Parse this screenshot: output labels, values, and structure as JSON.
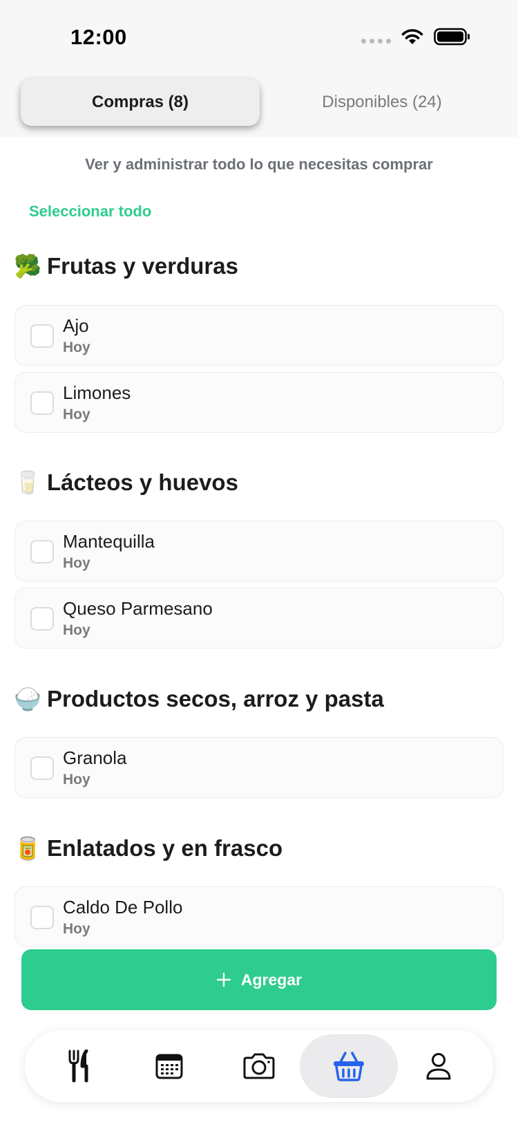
{
  "status_bar": {
    "time": "12:00"
  },
  "tabs": [
    {
      "label": "Compras (8)",
      "active": true
    },
    {
      "label": "Disponibles (24)",
      "active": false
    }
  ],
  "subtitle": "Ver y administrar todo lo que necesitas comprar",
  "select_all": "Seleccionar todo",
  "sections": [
    {
      "emoji": "🥦",
      "title": "Frutas y verduras",
      "items": [
        {
          "name": "Ajo",
          "when": "Hoy"
        },
        {
          "name": "Limones",
          "when": "Hoy"
        }
      ]
    },
    {
      "emoji": "🥛",
      "title": "Lácteos y huevos",
      "items": [
        {
          "name": "Mantequilla",
          "when": "Hoy"
        },
        {
          "name": "Queso Parmesano",
          "when": "Hoy"
        }
      ]
    },
    {
      "emoji": "🍚",
      "title": "Productos secos, arroz y pasta",
      "items": [
        {
          "name": "Granola",
          "when": "Hoy"
        }
      ]
    },
    {
      "emoji": "🥫",
      "title": "Enlatados y en frasco",
      "items": [
        {
          "name": "Caldo De Pollo",
          "when": "Hoy"
        }
      ]
    }
  ],
  "add_button": {
    "label": "Agregar"
  },
  "bottom_nav": [
    {
      "icon": "fork-knife-icon",
      "active": false
    },
    {
      "icon": "calendar-icon",
      "active": false
    },
    {
      "icon": "camera-icon",
      "active": false
    },
    {
      "icon": "basket-icon",
      "active": true
    },
    {
      "icon": "person-icon",
      "active": false
    }
  ],
  "colors": {
    "accent": "#2ecc8f",
    "active_icon": "#2563eb",
    "text": "#1c1c1e",
    "muted": "#7a7a7e"
  }
}
